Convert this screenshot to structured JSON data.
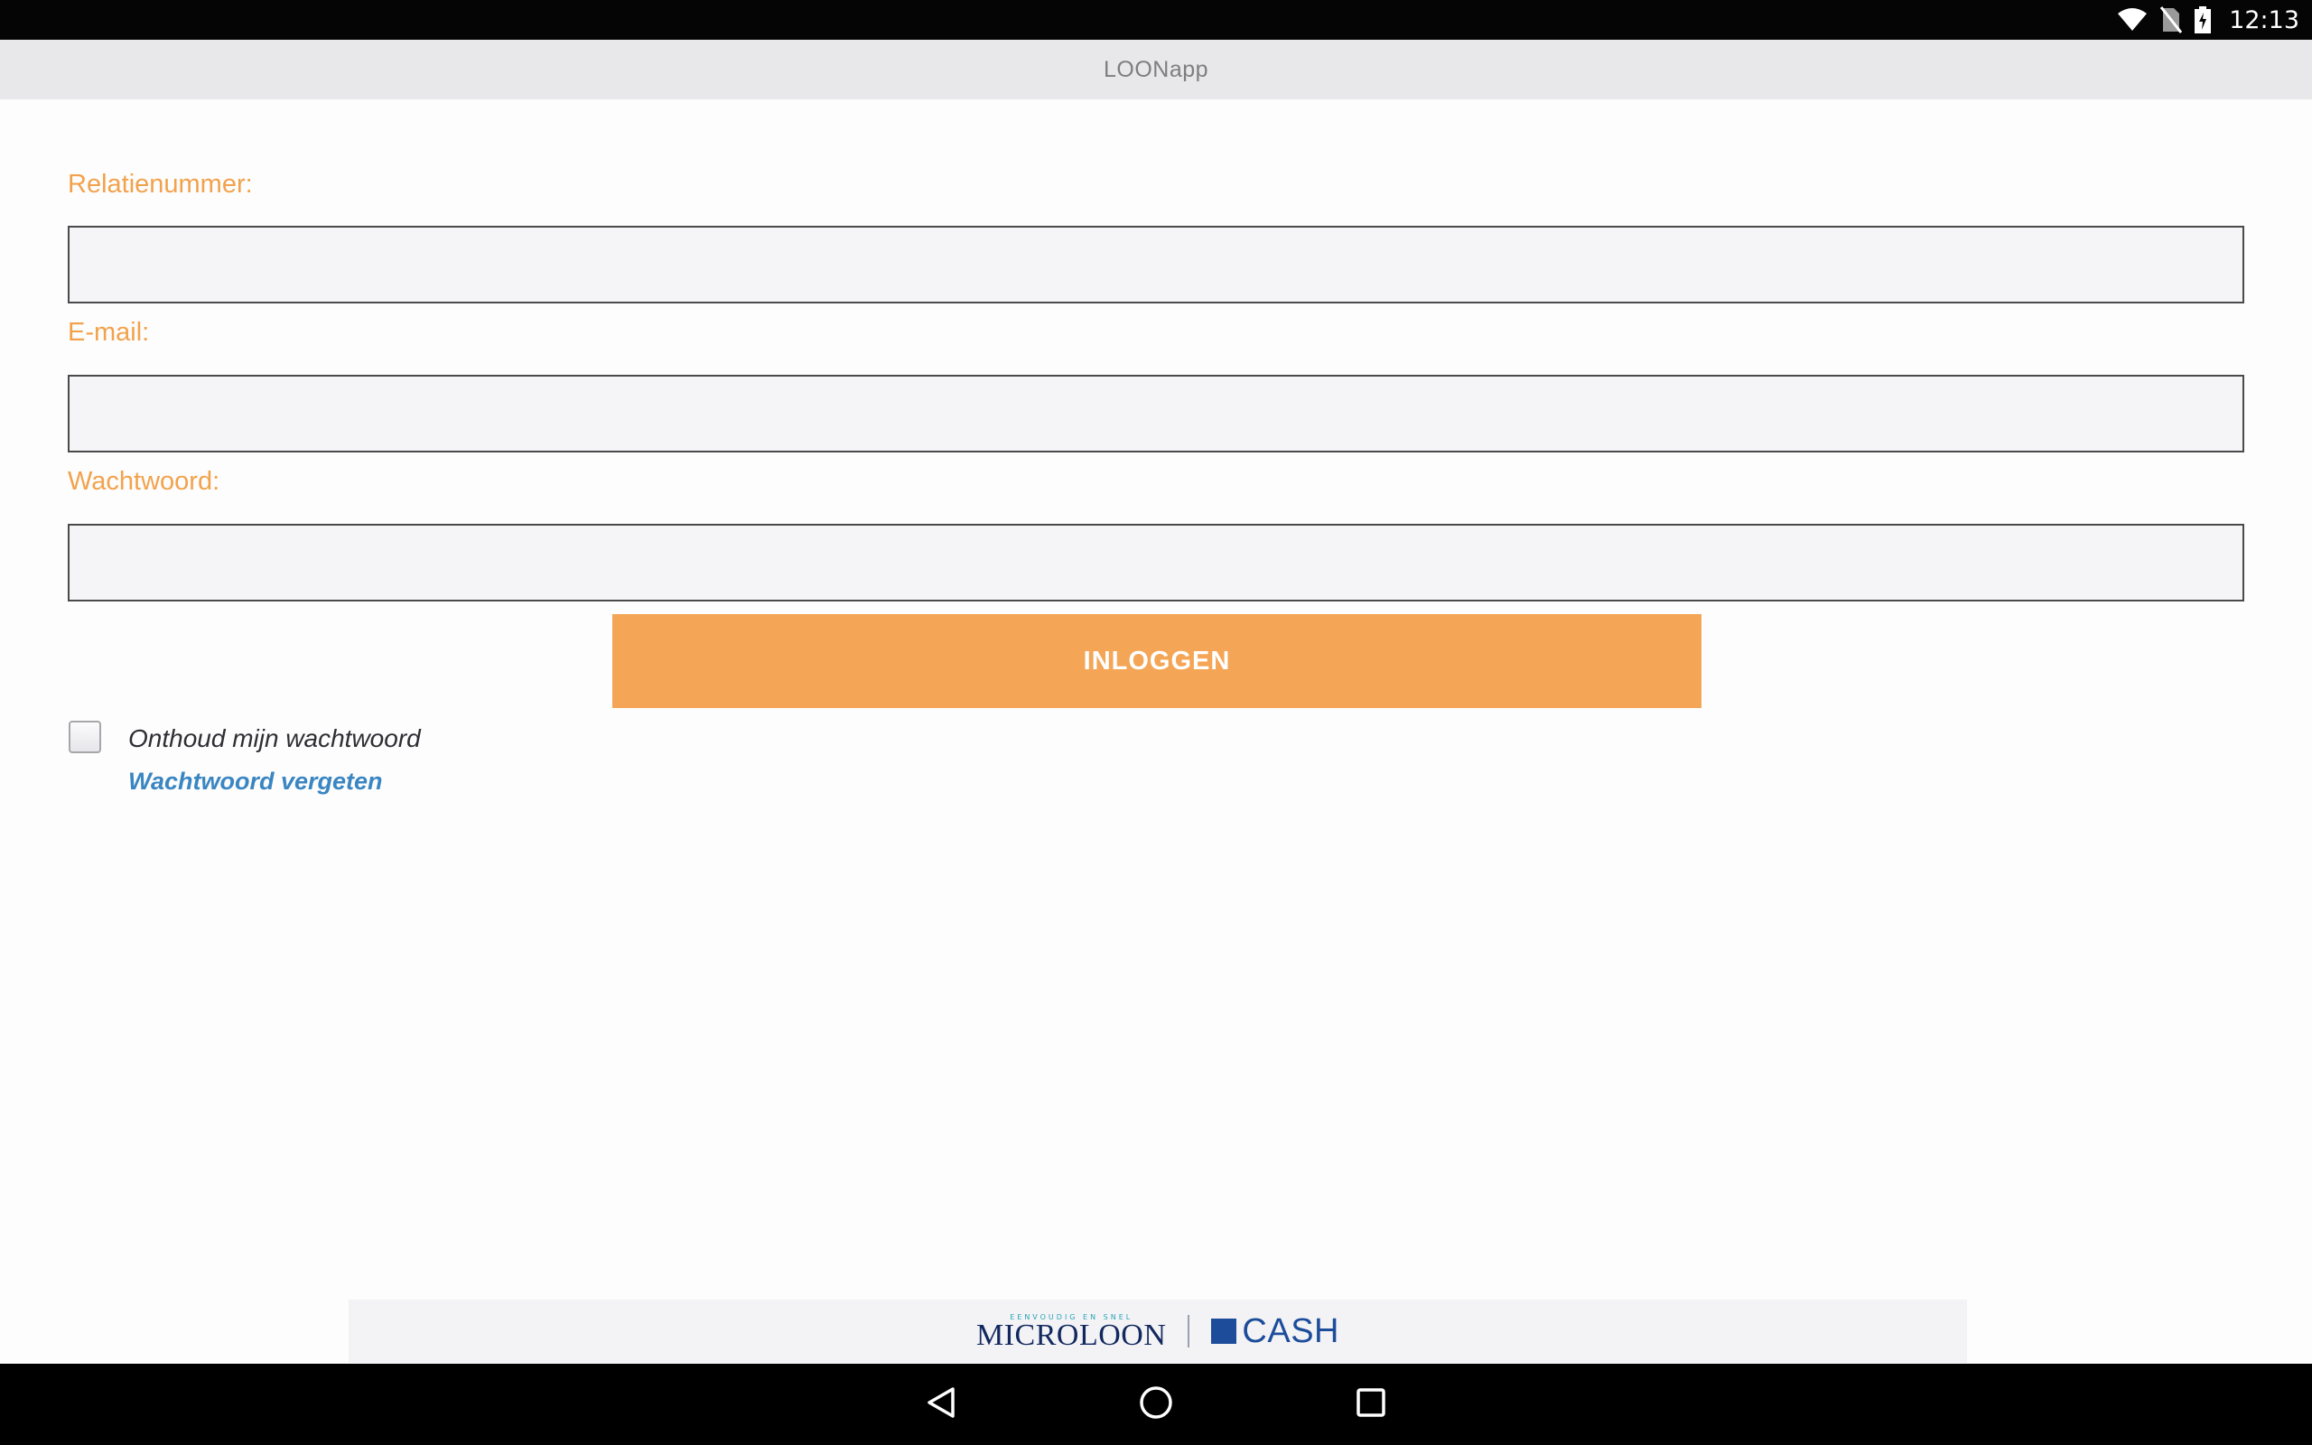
{
  "status_bar": {
    "time": "12:13",
    "icons": [
      "wifi-icon",
      "no-sim-icon",
      "battery-charging-icon"
    ]
  },
  "app": {
    "title": "LOONapp"
  },
  "form": {
    "relation_number": {
      "label": "Relatienummer:",
      "value": "",
      "placeholder": ""
    },
    "email": {
      "label": "E-mail:",
      "value": "",
      "placeholder": ""
    },
    "password": {
      "label": "Wachtwoord:",
      "value": "",
      "placeholder": ""
    },
    "login_button_label": "INLOGGEN",
    "remember_password": {
      "label": "Onthoud mijn wachtwoord",
      "checked": false
    },
    "forgot_password_link": "Wachtwoord vergeten"
  },
  "footer": {
    "microloon_tagline": "EENVOUDIG EN SNEL",
    "microloon_name": "MICROLOON",
    "cash_name": "CASH"
  },
  "colors": {
    "accent_orange": "#f4a556",
    "label_orange": "#f2a24c",
    "link_blue": "#3a86c2",
    "brand_navy": "#12285e",
    "cash_blue": "#1d4d9a"
  },
  "nav_bar": {
    "buttons": [
      "back-icon",
      "home-icon",
      "recents-icon"
    ]
  }
}
